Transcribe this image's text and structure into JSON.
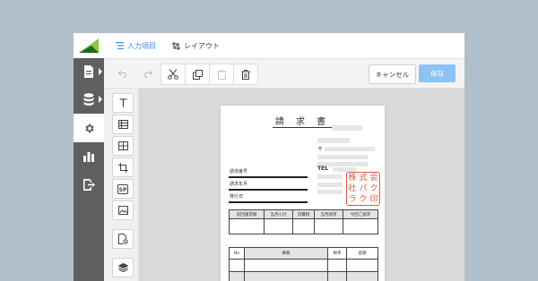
{
  "tabs": [
    {
      "label": "入力項目",
      "icon": "list-icon",
      "active": true
    },
    {
      "label": "レイアウト",
      "icon": "layout-icon",
      "active": false
    }
  ],
  "toolbar": {
    "cancel_label": "キャンセル",
    "save_label": "保存"
  },
  "colors": {
    "accent": "#3a8ee6",
    "save_button": "#8cc3f4",
    "sidebar": "#5f5f5f",
    "stamp": "#e0574a",
    "logo_dark": "#1c6b1f",
    "logo_light": "#8dc63f"
  },
  "document": {
    "title": "請 求 書",
    "postal_mark": "〒",
    "tel_label": "TEL",
    "fields": [
      "請求番号",
      "請求年月",
      "発行日"
    ],
    "stamp_chars": [
      "株",
      "式",
      "会",
      "社",
      "パ",
      "ク",
      "ラ",
      "ク",
      "印"
    ],
    "summary_headers": [
      "前回請求額",
      "当月小計",
      "消費税",
      "当月請求",
      "今回ご請求"
    ],
    "detail_headers": [
      "No",
      "摘要",
      "税率",
      "金額"
    ]
  }
}
